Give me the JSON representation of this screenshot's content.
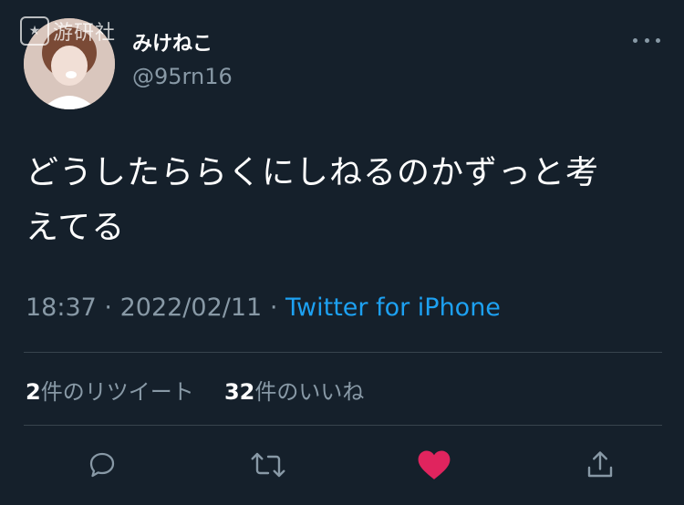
{
  "user": {
    "display_name": "みけねこ",
    "handle": "@95rn16"
  },
  "watermark": {
    "text": "游研社"
  },
  "tweet": {
    "text_line1": "どうしたららくにしねるのかずっと考",
    "text_line2": "えてる",
    "time": "18:37",
    "date": "2022/02/11",
    "source": "Twitter for iPhone",
    "separator": "·"
  },
  "stats": {
    "retweets_count": "2",
    "retweets_label": "件のリツイート",
    "likes_count": "32",
    "likes_label": "件のいいね"
  },
  "actions": [
    {
      "name": "reply",
      "icon": "reply-icon"
    },
    {
      "name": "retweet",
      "icon": "retweet-icon"
    },
    {
      "name": "like",
      "icon": "heart-icon",
      "active": true
    },
    {
      "name": "share",
      "icon": "share-icon"
    }
  ],
  "colors": {
    "background": "#15202b",
    "secondary_text": "#8899a6",
    "link": "#1da1f2",
    "like_active": "#e0245e",
    "divider": "#38444d"
  }
}
